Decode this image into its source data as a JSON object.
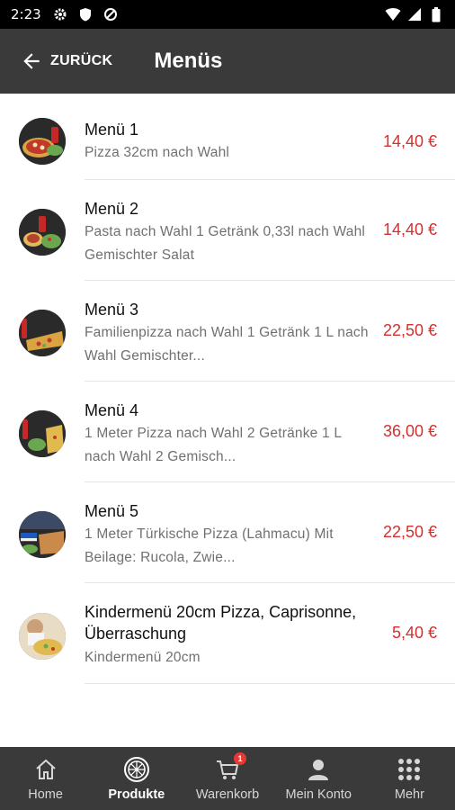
{
  "status_bar": {
    "time": "2:23"
  },
  "header": {
    "back_label": "ZURÜCK",
    "title": "Menüs"
  },
  "colors": {
    "price": "#d32f2f",
    "app_bar": "#3a3a3a",
    "badge": "#e53935"
  },
  "items": [
    {
      "title": "Menü 1",
      "description": "Pizza 32cm nach Wahl",
      "price": "14,40 €"
    },
    {
      "title": "Menü 2",
      "description": "Pasta nach Wahl 1 Getränk 0,33l nach Wahl Gemischter Salat",
      "price": "14,40 €"
    },
    {
      "title": "Menü 3",
      "description": "Familienpizza nach Wahl 1 Getränk 1 L nach Wahl Gemischter...",
      "price": "22,50 €"
    },
    {
      "title": "Menü 4",
      "description": "1 Meter Pizza nach Wahl 2 Getränke 1 L nach Wahl 2 Gemisch...",
      "price": "36,00 €"
    },
    {
      "title": "Menü 5",
      "description": "1 Meter Türkische Pizza (Lahmacu) Mit Beilage: Rucola, Zwie...",
      "price": "22,50 €"
    },
    {
      "title": "Kindermenü 20cm Pizza, Caprisonne, Überraschung",
      "description": "Kindermenü 20cm",
      "price": "5,40 €"
    }
  ],
  "bottom_nav": {
    "home": "Home",
    "products": "Produkte",
    "cart": "Warenkorb",
    "cart_badge": "1",
    "account": "Mein Konto",
    "more": "Mehr"
  }
}
